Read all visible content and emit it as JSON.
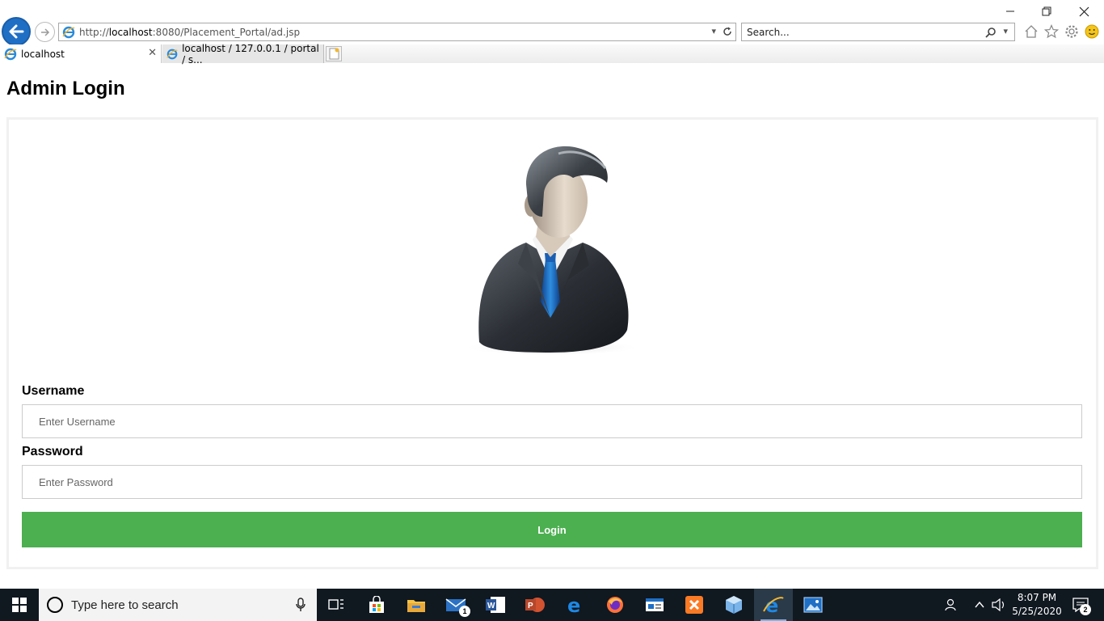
{
  "browser": {
    "url_prefix": "http://",
    "url_host": "localhost",
    "url_rest": ":8080/Placement_Portal/ad.jsp",
    "search_placeholder": "Search...",
    "tabs": [
      {
        "label": "localhost",
        "active": true
      },
      {
        "label": "localhost / 127.0.0.1 / portal / s...",
        "active": false
      }
    ],
    "window_controls": {
      "minimize": "—",
      "restore": "❐",
      "close": "✕"
    }
  },
  "page": {
    "title": "Admin Login",
    "username_label": "Username",
    "username_placeholder": "Enter Username",
    "password_label": "Password",
    "password_placeholder": "Enter Password",
    "login_button": "Login",
    "button_color": "#4caf50"
  },
  "taskbar": {
    "search_placeholder": "Type here to search",
    "time": "8:07 PM",
    "date": "5/25/2020",
    "mail_badge": "1",
    "notification_badge": "2"
  }
}
